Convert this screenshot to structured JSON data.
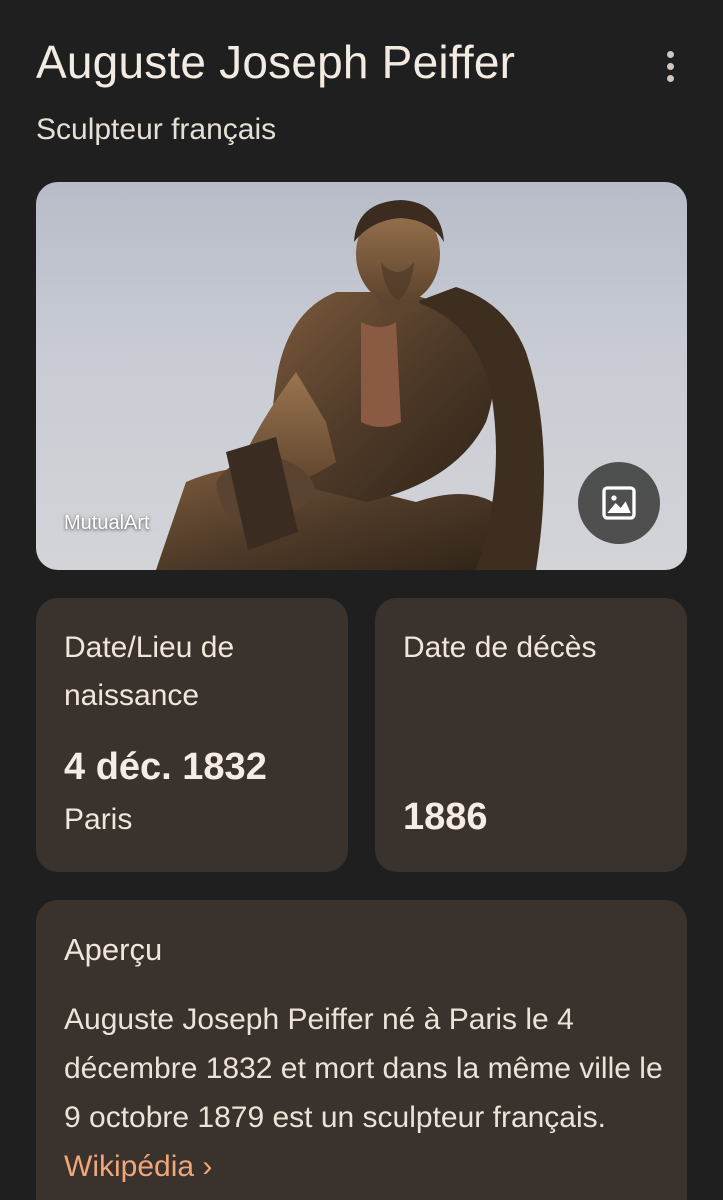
{
  "header": {
    "title": "Auguste Joseph Peiffer",
    "subtitle": "Sculpteur français",
    "more_icon": "more-vert-icon"
  },
  "hero": {
    "source": "MutualArt",
    "image_button_icon": "image-icon"
  },
  "birth_card": {
    "label": "Date/Lieu de naissance",
    "date": "4 déc. 1832",
    "place": "Paris"
  },
  "death_card": {
    "label": "Date de décès",
    "date": "1886"
  },
  "overview": {
    "heading": "Aperçu",
    "text": "Auguste Joseph Peiffer né à Paris le 4 décembre 1832 et mort dans la même ville le 9 octobre 1879 est un sculpteur français.",
    "source_link": "Wikipédia",
    "source_arrow": "›"
  },
  "colors": {
    "background": "#1f1f1f",
    "card": "#3a322c",
    "link": "#f0a57a"
  }
}
